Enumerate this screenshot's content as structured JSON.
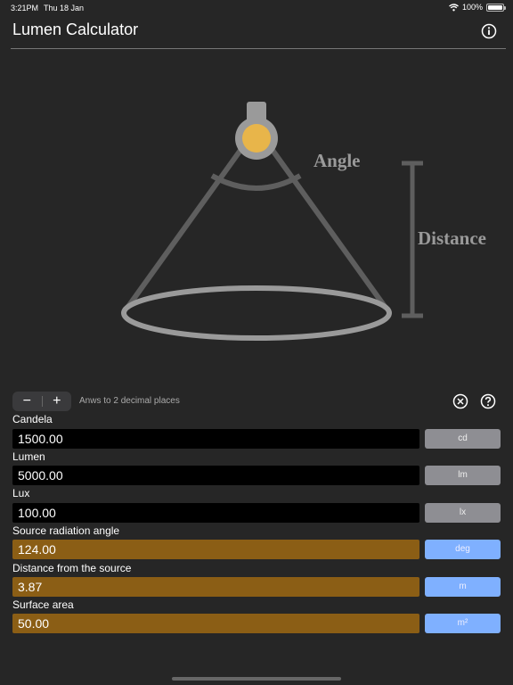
{
  "status": {
    "time": "3:21PM",
    "date": "Thu 18 Jan",
    "battery": "100%"
  },
  "nav": {
    "title": "Lumen Calculator"
  },
  "illustration": {
    "angle_label": "Angle",
    "distance_label": "Distance"
  },
  "toolbar": {
    "minus": "−",
    "plus": "+",
    "precision_text": "Anws to 2 decimal places"
  },
  "fields": [
    {
      "label": "Candela",
      "value": "1500.00",
      "unit": "cd"
    },
    {
      "label": "Lumen",
      "value": "5000.00",
      "unit": "lm"
    },
    {
      "label": "Lux",
      "value": "100.00",
      "unit": "lx"
    },
    {
      "label": "Source radiation angle",
      "value": "124.00",
      "unit": "deg"
    },
    {
      "label": "Distance from the source",
      "value": "3.87",
      "unit": "m"
    },
    {
      "label": "Surface area",
      "value": "50.00",
      "unit": "m²"
    }
  ],
  "colors": {
    "background": "#262626",
    "input_field": "#8b5e15",
    "calc_field": "#000000",
    "unit_active": "#7fb0ff",
    "unit_inactive": "#8e8e93",
    "bulb": "#e8b54a"
  }
}
